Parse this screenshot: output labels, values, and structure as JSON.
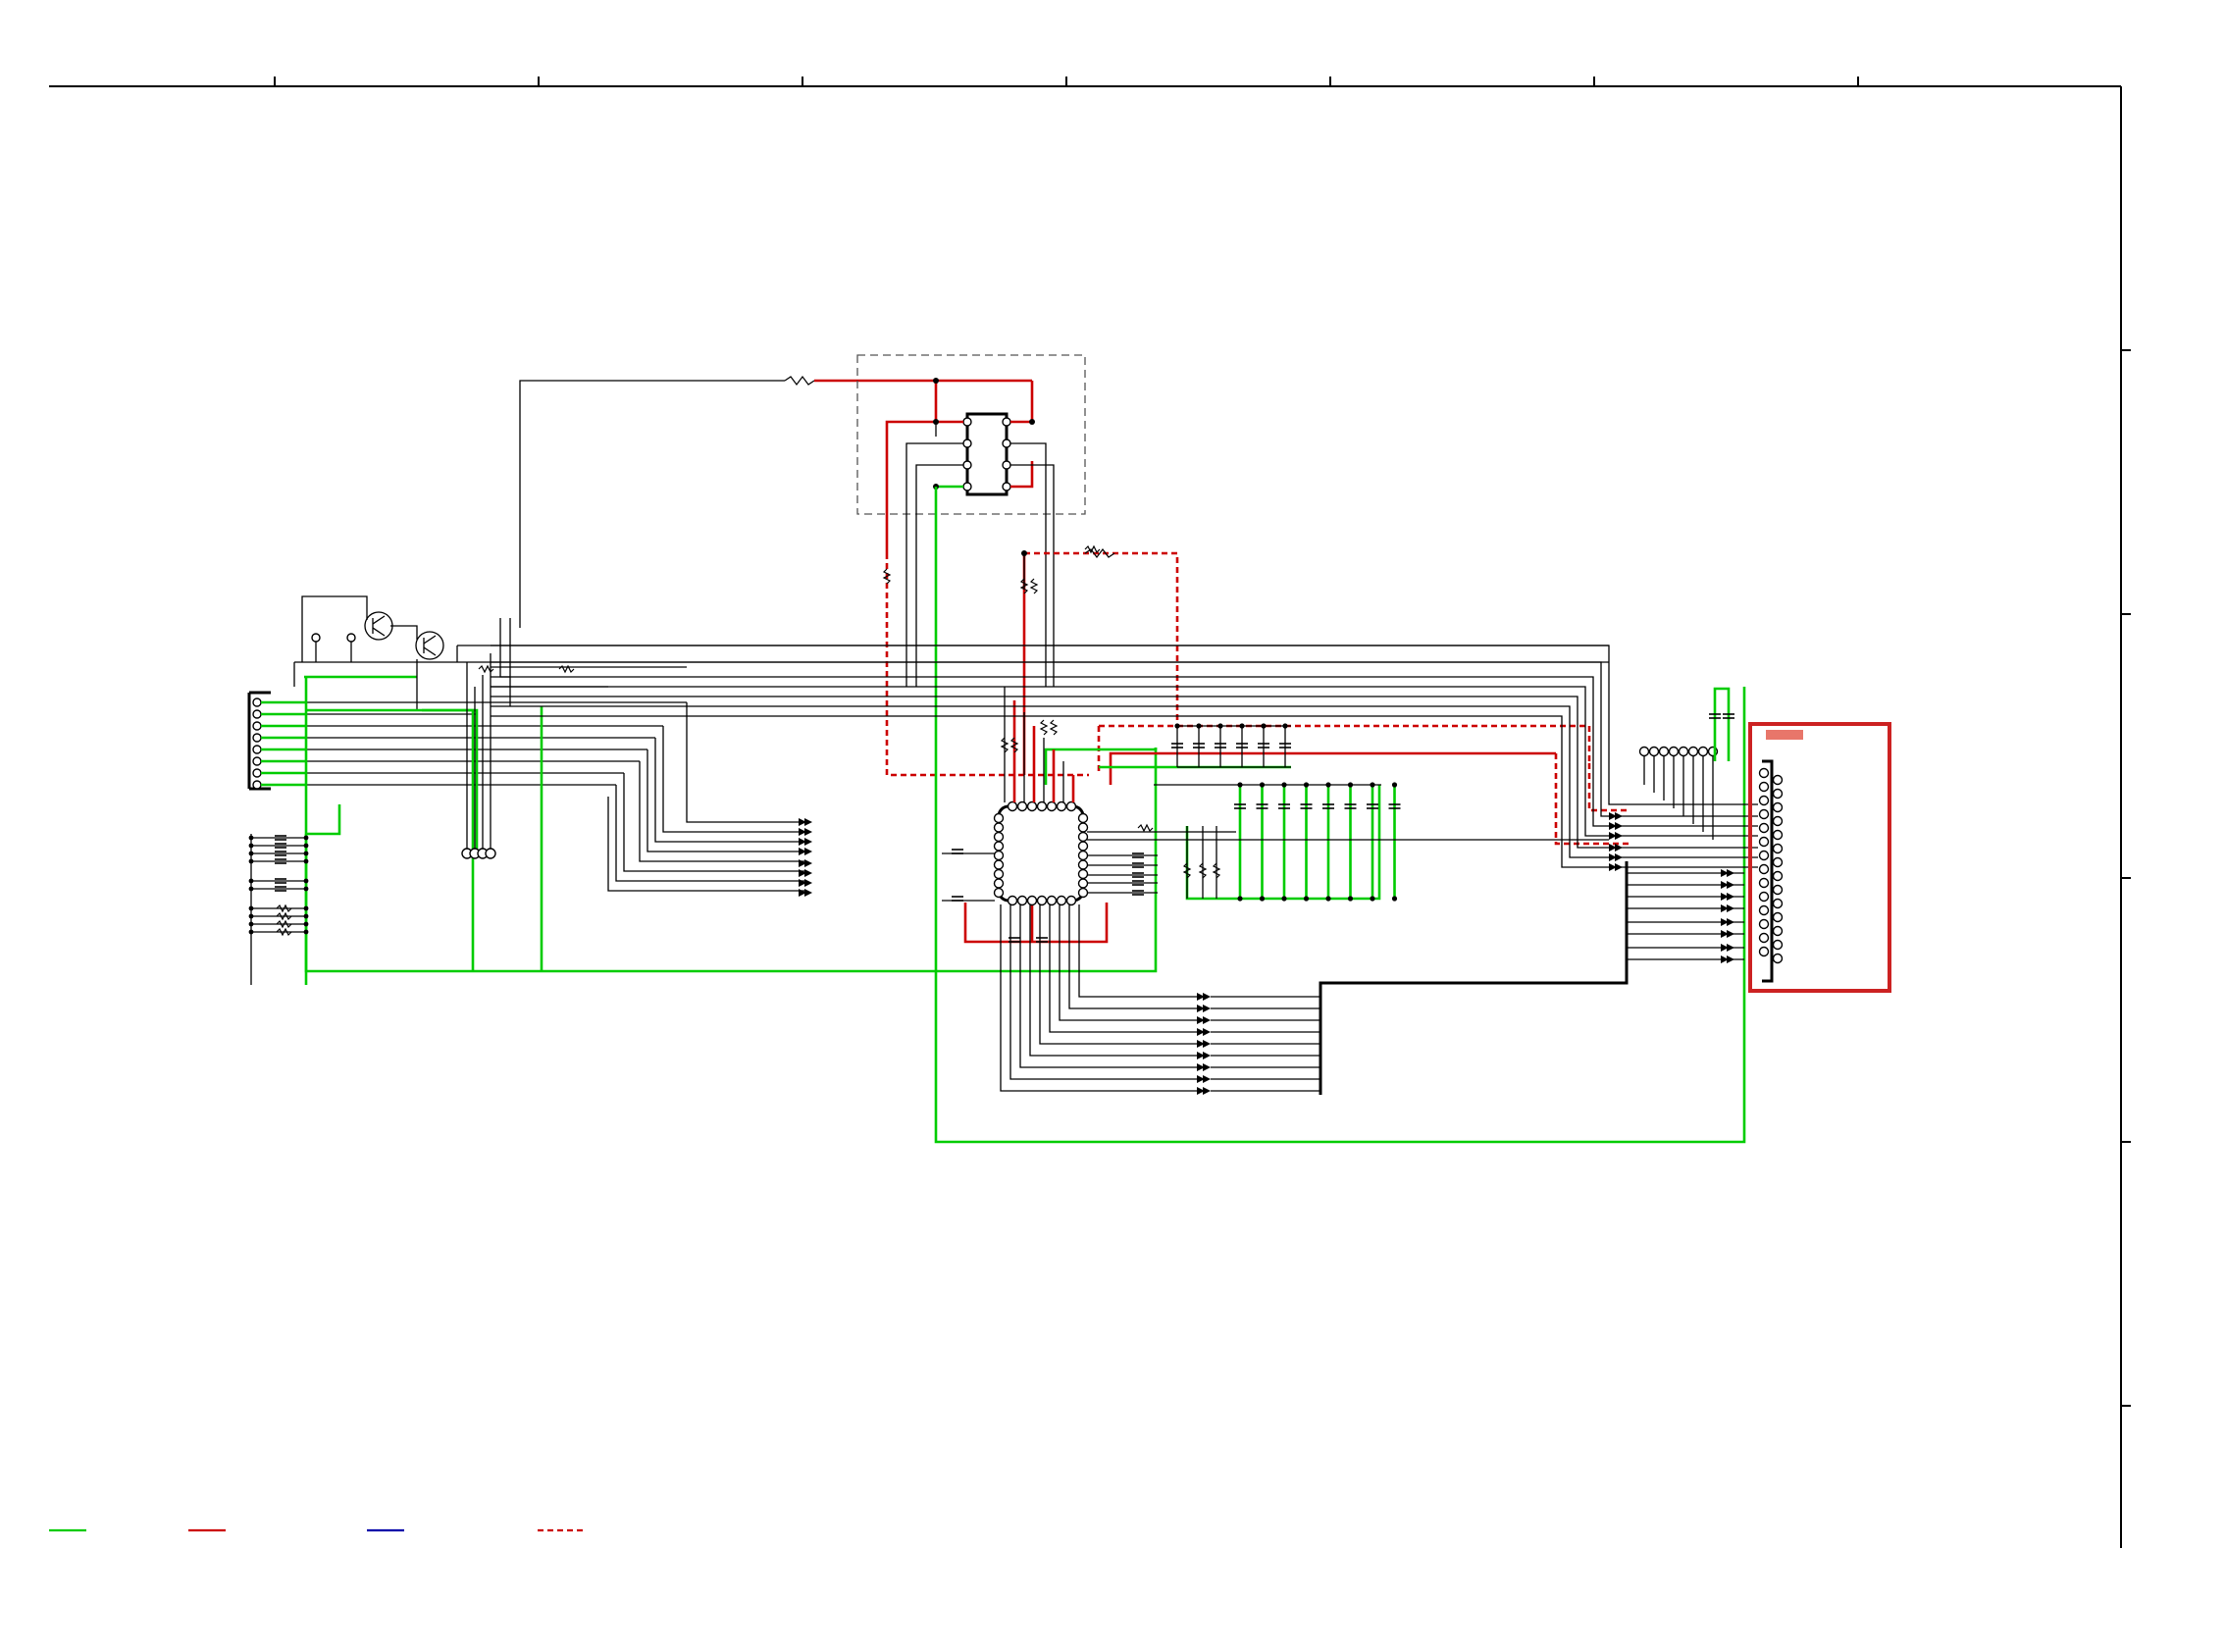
{
  "diagram": {
    "legend": [
      {
        "id": "legend-green",
        "color": "#00cc00",
        "style": "solid"
      },
      {
        "id": "legend-red",
        "color": "#cc0000",
        "style": "solid"
      },
      {
        "id": "legend-blue",
        "color": "#0000aa",
        "style": "solid"
      },
      {
        "id": "legend-red-dashed",
        "color": "#cc0000",
        "style": "dashed"
      }
    ],
    "colors": {
      "ground_trace": "#00cc00",
      "power_trace": "#cc0000",
      "signal_trace": "#000000",
      "connector_highlight": "#cc2222",
      "connector_label_fill": "#e8766a"
    }
  }
}
